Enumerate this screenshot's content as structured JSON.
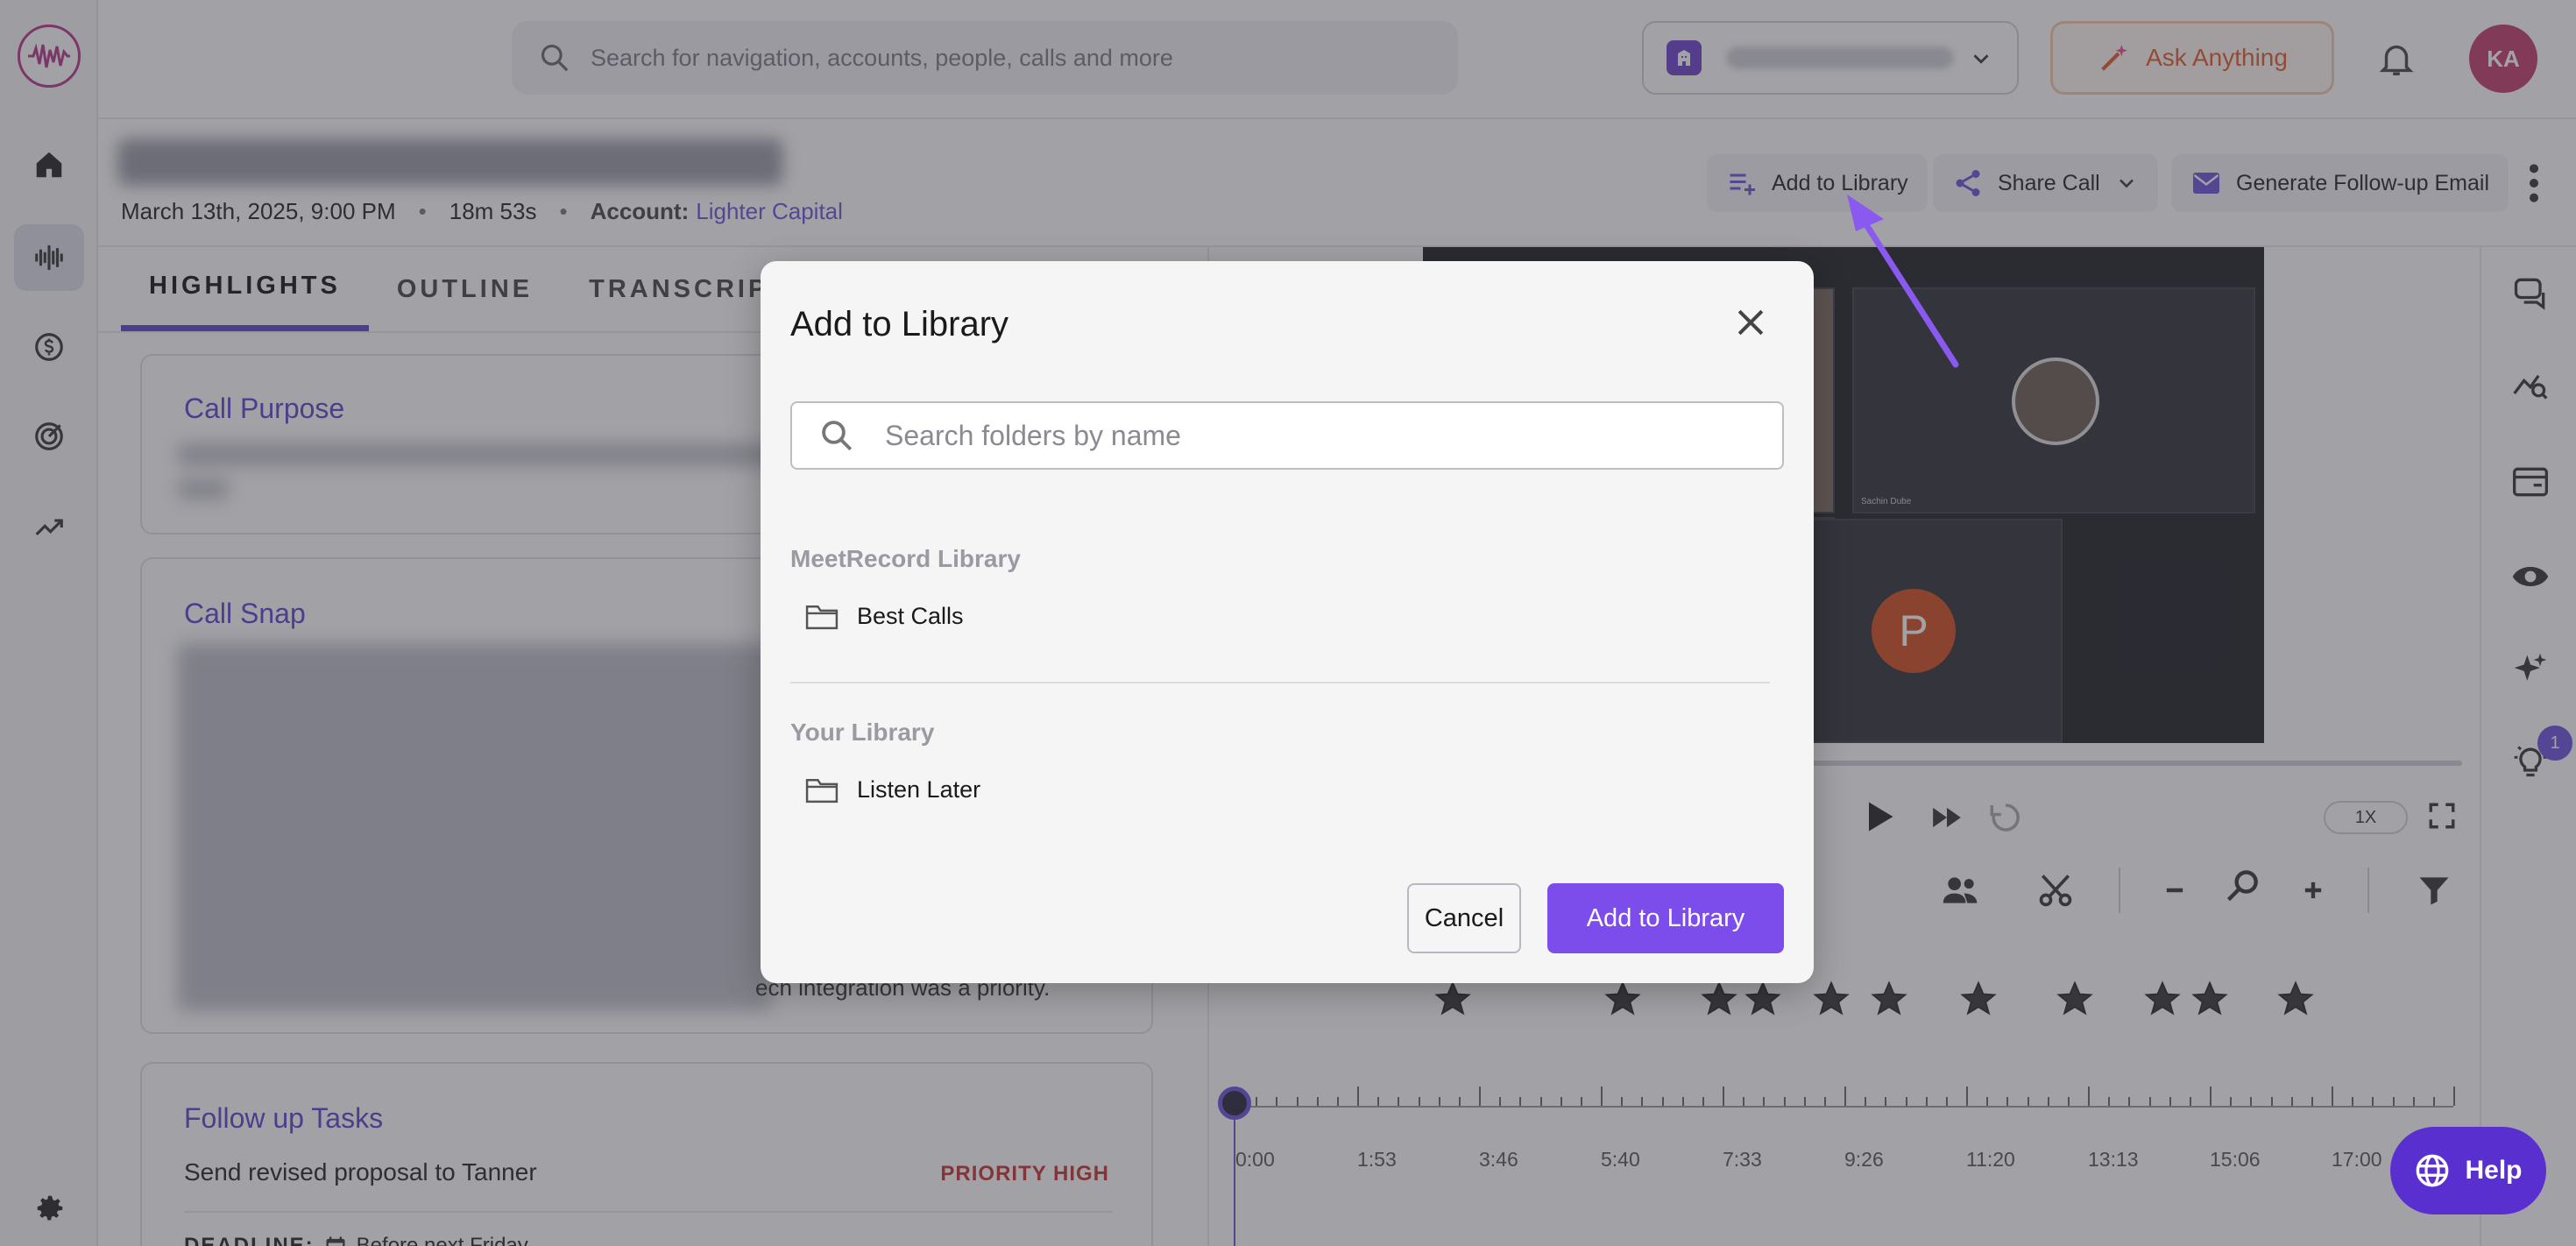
{
  "topbar": {
    "search_placeholder": "Search for navigation, accounts, people, calls and more",
    "ask_label": "Ask Anything",
    "avatar_initials": "KA"
  },
  "call": {
    "date": "March 13th, 2025, 9:00 PM",
    "duration": "18m 53s",
    "account_label": "Account:",
    "account_name": "Lighter Capital",
    "separator": "•"
  },
  "header_actions": {
    "add_to_library": "Add to Library",
    "share_call": "Share Call",
    "generate_email": "Generate Follow-up Email"
  },
  "tabs": [
    {
      "label": "HIGHLIGHTS"
    },
    {
      "label": "OUTLINE"
    },
    {
      "label": "TRANSCRIPT"
    }
  ],
  "cards": {
    "call_purpose": "Call Purpose",
    "call_snap": "Call Snap",
    "snap_visible_line": "ech integration was a priority.",
    "follow_up": "Follow up Tasks",
    "task_text": "Send revised proposal to Tanner",
    "priority": "PRIORITY HIGH",
    "deadline_label": "DEADLINE:",
    "deadline_value": "Before next Friday"
  },
  "video": {
    "participant_initial": "P",
    "participant_name": "Sachin Dube"
  },
  "player": {
    "speed": "1X"
  },
  "timeline": {
    "labels": [
      "0:00",
      "1:53",
      "3:46",
      "5:40",
      "7:33",
      "9:26",
      "11:20",
      "13:13",
      "15:06",
      "17:00"
    ]
  },
  "right_rail": {
    "badge_count": "1"
  },
  "help_label": "Help",
  "modal": {
    "title": "Add to Library",
    "search_placeholder": "Search folders by name",
    "sections": [
      {
        "title": "MeetRecord Library",
        "folders": [
          "Best Calls"
        ]
      },
      {
        "title": "Your Library",
        "folders": [
          "Listen Later"
        ]
      }
    ],
    "cancel_label": "Cancel",
    "confirm_label": "Add to Library"
  },
  "colors": {
    "accent": "#7c4dea",
    "brand_purple": "#5b3fd0",
    "ask_orange": "#e0582a",
    "priority_red": "#c03030",
    "overlay": "rgba(60,60,70,0.48)"
  }
}
